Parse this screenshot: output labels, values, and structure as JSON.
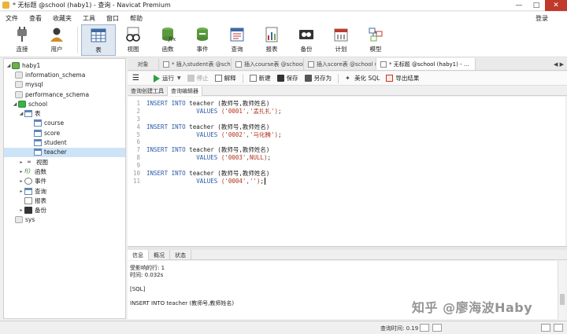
{
  "window": {
    "title": "* 无标题 @school (haby1) - 查询 - Navicat Premium"
  },
  "menu": [
    "文件",
    "查看",
    "收藏夹",
    "工具",
    "窗口",
    "帮助"
  ],
  "login_label": "登录",
  "toolbar": {
    "connect": "连接",
    "user": "用户",
    "table": "表",
    "view": "视图",
    "function": "函数",
    "event": "事件",
    "query": "查询",
    "report": "报表",
    "backup": "备份",
    "schedule": "计划",
    "model": "模型"
  },
  "tree": {
    "connection": "haby1",
    "databases": [
      "information_schema",
      "mysql",
      "performance_schema"
    ],
    "active_db": "school",
    "tables_label": "表",
    "tables": [
      "course",
      "score",
      "student",
      "teacher"
    ],
    "selected_table": "teacher",
    "folders": [
      "视图",
      "函数",
      "事件",
      "查询",
      "报表",
      "备份"
    ],
    "other_db": "sys"
  },
  "tabs": {
    "objects": "对象",
    "t1": "* 插入student表 @school (h...",
    "t2": "插入course表 @school (hab...",
    "t3": "插入score表 @school (hab...",
    "t4": "* 无标题 @school (haby1) - ..."
  },
  "query_toolbar": {
    "run": "运行",
    "stop": "停止",
    "explain": "解释",
    "new": "新建",
    "save": "保存",
    "save_as": "另存为",
    "beautify": "美化 SQL",
    "export": "导出结果"
  },
  "subtabs": {
    "builder": "查询创建工具",
    "editor": "查询编辑器"
  },
  "editor": {
    "line_numbers": [
      "1",
      "2",
      "3",
      "4",
      "5",
      "6",
      "7",
      "8",
      "9",
      "10",
      "11"
    ],
    "l1_kw": "INSERT INTO",
    "l1_rest": " teacher (教师号,教师姓名)",
    "l2_kw": "VALUES",
    "l2_str": "('0001','孟扎扎')",
    "l2_end": ";",
    "l4_kw": "INSERT INTO",
    "l4_rest": " teacher (教师号,教师姓名)",
    "l5_kw": "VALUES",
    "l5_str": "('0002','马化腾')",
    "l5_end": ";",
    "l7_kw": "INSERT INTO",
    "l7_rest": " teacher (教师号,教师姓名)",
    "l8_kw": "VALUES",
    "l8_str": "('0003',NULL)",
    "l8_end": ";",
    "l10_kw": "INSERT INTO",
    "l10_rest": " teacher (教师号,教师姓名)",
    "l11_kw": "VALUES",
    "l11_str": "('0004','')",
    "l11_end": ";"
  },
  "result_tabs": {
    "info": "信息",
    "overview": "概况",
    "status": "状态"
  },
  "result": {
    "affected": "受影响的行: 1",
    "time": "时间: 0.032s",
    "sql_tag": "[SQL]",
    "sql_text": "INSERT INTO teacher (教师号,教师姓名)"
  },
  "status_bar": {
    "query_time": "查询时间: 0.19"
  },
  "watermark": "知乎 @廖海波Haby"
}
